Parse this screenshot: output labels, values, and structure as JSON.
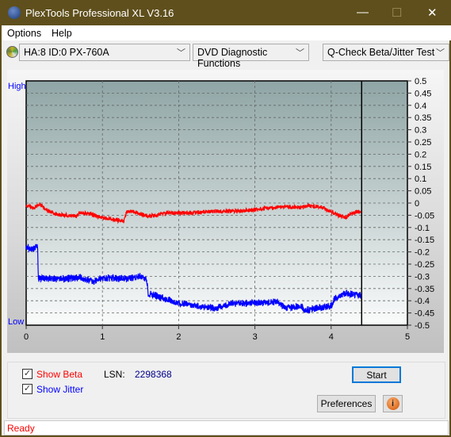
{
  "window": {
    "title": "PlexTools Professional XL V3.16",
    "logo_text": "XL"
  },
  "menu": [
    {
      "label": "Options"
    },
    {
      "label": "Help"
    }
  ],
  "toolbar": {
    "drive": "HA:8 ID:0  PX-760A",
    "function": "DVD Diagnostic Functions",
    "test": "Q-Check Beta/Jitter Test"
  },
  "chart_data": {
    "type": "line",
    "left_labels": {
      "high": "High",
      "low": "Low"
    },
    "xlim": [
      0,
      5
    ],
    "ylim": [
      -0.5,
      0.5
    ],
    "x_ticks": [
      "0",
      "1",
      "2",
      "3",
      "4",
      "5"
    ],
    "y_ticks": [
      "0.5",
      "0.45",
      "0.4",
      "0.35",
      "0.3",
      "0.25",
      "0.2",
      "0.15",
      "0.1",
      "0.05",
      "0",
      "-0.05",
      "-0.1",
      "-0.15",
      "-0.2",
      "-0.25",
      "-0.3",
      "-0.35",
      "-0.4",
      "-0.45",
      "-0.5"
    ],
    "grid": true,
    "marker_x": 4.4,
    "series": [
      {
        "name": "Beta",
        "color": "#ff0000",
        "points": [
          [
            0,
            -0.01
          ],
          [
            0.1,
            -0.02
          ],
          [
            0.18,
            -0.005
          ],
          [
            0.3,
            -0.035
          ],
          [
            0.4,
            -0.045
          ],
          [
            0.5,
            -0.05
          ],
          [
            0.65,
            -0.055
          ],
          [
            0.7,
            -0.04
          ],
          [
            0.85,
            -0.045
          ],
          [
            1.0,
            -0.06
          ],
          [
            1.1,
            -0.065
          ],
          [
            1.2,
            -0.07
          ],
          [
            1.28,
            -0.075
          ],
          [
            1.32,
            -0.035
          ],
          [
            1.4,
            -0.035
          ],
          [
            1.5,
            -0.045
          ],
          [
            1.6,
            -0.055
          ],
          [
            1.7,
            -0.05
          ],
          [
            1.85,
            -0.04
          ],
          [
            2.0,
            -0.04
          ],
          [
            2.2,
            -0.04
          ],
          [
            2.4,
            -0.035
          ],
          [
            2.6,
            -0.035
          ],
          [
            2.8,
            -0.032
          ],
          [
            3.0,
            -0.028
          ],
          [
            3.2,
            -0.02
          ],
          [
            3.4,
            -0.015
          ],
          [
            3.6,
            -0.02
          ],
          [
            3.7,
            -0.01
          ],
          [
            3.9,
            -0.02
          ],
          [
            4.0,
            -0.035
          ],
          [
            4.1,
            -0.05
          ],
          [
            4.2,
            -0.06
          ],
          [
            4.25,
            -0.045
          ],
          [
            4.35,
            -0.035
          ],
          [
            4.4,
            -0.035
          ]
        ]
      },
      {
        "name": "Jitter",
        "color": "#0000ff",
        "points": [
          [
            0,
            -0.18
          ],
          [
            0.1,
            -0.19
          ],
          [
            0.15,
            -0.17
          ],
          [
            0.16,
            -0.31
          ],
          [
            0.3,
            -0.31
          ],
          [
            0.5,
            -0.31
          ],
          [
            0.7,
            -0.305
          ],
          [
            0.9,
            -0.32
          ],
          [
            1.0,
            -0.305
          ],
          [
            1.3,
            -0.31
          ],
          [
            1.5,
            -0.3
          ],
          [
            1.58,
            -0.31
          ],
          [
            1.6,
            -0.37
          ],
          [
            1.8,
            -0.39
          ],
          [
            2.0,
            -0.41
          ],
          [
            2.2,
            -0.42
          ],
          [
            2.5,
            -0.43
          ],
          [
            2.7,
            -0.41
          ],
          [
            3.0,
            -0.41
          ],
          [
            3.3,
            -0.405
          ],
          [
            3.4,
            -0.43
          ],
          [
            3.6,
            -0.42
          ],
          [
            3.65,
            -0.44
          ],
          [
            3.9,
            -0.425
          ],
          [
            4.0,
            -0.42
          ],
          [
            4.05,
            -0.39
          ],
          [
            4.2,
            -0.37
          ],
          [
            4.4,
            -0.38
          ]
        ]
      }
    ]
  },
  "controls": {
    "show_beta": "Show Beta",
    "show_beta_checked": true,
    "show_jitter": "Show Jitter",
    "show_jitter_checked": true,
    "lsn_label": "LSN:",
    "lsn_value": "2298368",
    "start": "Start",
    "preferences": "Preferences",
    "info_icon": "info-icon"
  },
  "status": "Ready"
}
